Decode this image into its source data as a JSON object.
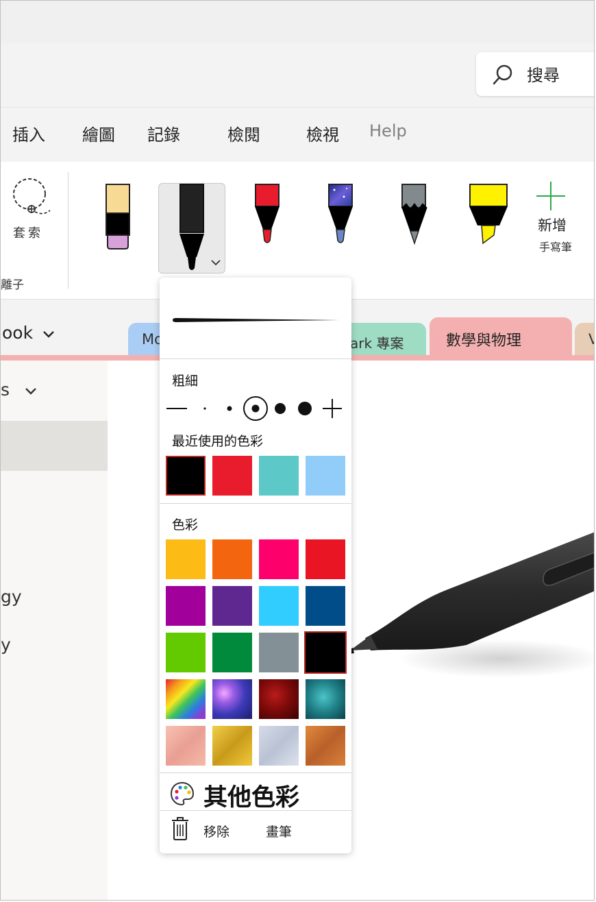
{
  "search": {
    "label": "搜尋"
  },
  "menu": [
    {
      "label": "插入"
    },
    {
      "label": "繪圖"
    },
    {
      "label": "記錄"
    },
    {
      "label": "檢閱"
    },
    {
      "label": "檢視"
    },
    {
      "label": "Help"
    }
  ],
  "ribbon": {
    "lasso_label": "套索",
    "group_label": "橡皮擦/選取／離子",
    "group_label_visible": "離子",
    "add_pen_label": "新增",
    "add_pen_sub": "手寫筆"
  },
  "notebook": {
    "name": "ook"
  },
  "tabs": [
    {
      "label": "Mo",
      "color": "#a9cdf4"
    },
    {
      "label": "ark 專案",
      "color": "#9fdcc4"
    },
    {
      "label": "數學與物理",
      "color": "#f4b0b0"
    },
    {
      "label": "V",
      "color": "#e7cdb5"
    }
  ],
  "sidebar": {
    "section_fragment": "s",
    "items": [
      {
        "label": "gy"
      },
      {
        "label": "y"
      }
    ]
  },
  "popup": {
    "thickness_label": "粗細",
    "recent_label": "最近使用的色彩",
    "colors_label": "色彩",
    "more_colors_label": "其他色彩",
    "remove_label": "移除",
    "pen_label": "畫筆",
    "recent_colors": [
      "#000000",
      "#e81c2c",
      "#5cc8c8",
      "#92cdfa"
    ],
    "color_rows": [
      [
        "#fdbb16",
        "#f4650f",
        "#fe006c",
        "#e91525"
      ],
      [
        "#a1009b",
        "#5f2891",
        "#30cdfe",
        "#014d8a"
      ],
      [
        "#63c901",
        "#018a3c",
        "#839196",
        "#000000"
      ]
    ],
    "texture_rows": [
      [
        "rainbow",
        "galaxy",
        "ruby",
        "ocean"
      ],
      [
        "rose-gold",
        "gold",
        "silver",
        "bronze"
      ]
    ]
  },
  "colors": {
    "accent_add": "#2aa94a",
    "selection_border": "#c0281f",
    "active_tab": "#f4b0b0"
  }
}
